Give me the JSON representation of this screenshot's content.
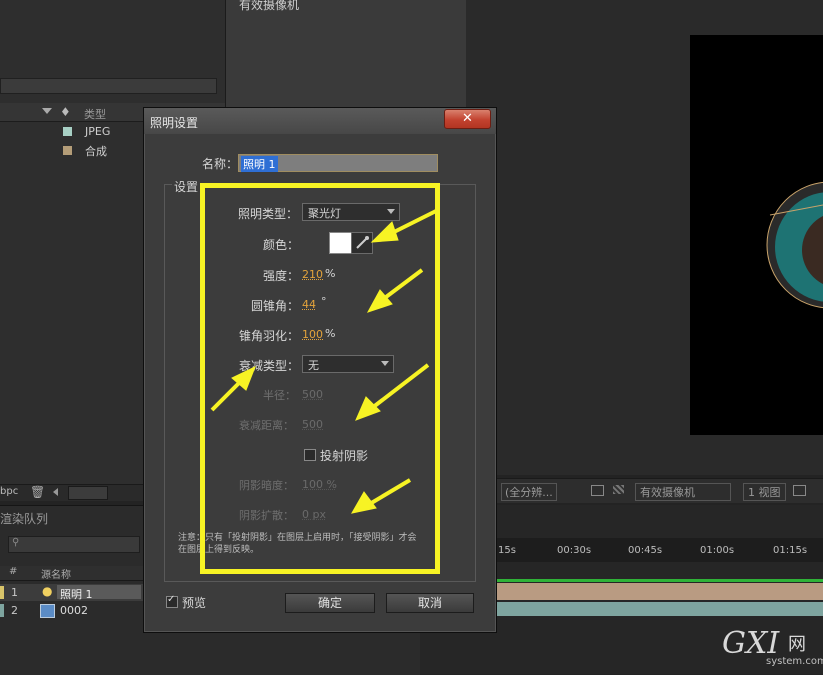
{
  "project": {
    "header_type": "类型",
    "items": [
      {
        "type": "JPEG",
        "swatch": "#a7cfc4"
      },
      {
        "type": "合成",
        "swatch": "#b49d78"
      }
    ]
  },
  "middle": {
    "title": "有效摄像机"
  },
  "comp_bar": {
    "zoom": "(全分辨...",
    "camera": "有效摄像机",
    "view": "1 视图"
  },
  "timeline": {
    "render_queue": "渲染队列",
    "cols": {
      "num": "#",
      "source": "源名称"
    },
    "layers": [
      {
        "num": "1",
        "name": "照明 1"
      },
      {
        "num": "2",
        "name": "0002"
      }
    ],
    "ticks": [
      "15s",
      "00:30s",
      "00:45s",
      "01:00s",
      "01:15s"
    ],
    "bpc": "bpc"
  },
  "dialog": {
    "title": "照明设置",
    "close": "✕",
    "name_label": "名称：",
    "name_value": "照明 1",
    "group_label": "设置",
    "light_type_label": "照明类型：",
    "light_type_value": "聚光灯",
    "color_label": "颜色：",
    "color_value": "#ffffff",
    "intensity_label": "强度：",
    "intensity_value": "210",
    "intensity_unit": "%",
    "cone_angle_label": "圆锥角：",
    "cone_angle_value": "44",
    "cone_angle_unit": "°",
    "cone_feather_label": "锥角羽化：",
    "cone_feather_value": "100",
    "cone_feather_unit": "%",
    "falloff_label": "衰减类型：",
    "falloff_value": "无",
    "radius_label": "半径：",
    "radius_value": "500",
    "falloff_distance_label": "衰减距离：",
    "falloff_distance_value": "500",
    "cast_shadows_label": "投射阴影",
    "shadow_darkness_label": "阴影暗度：",
    "shadow_darkness_value": "100 %",
    "shadow_diffusion_label": "阴影扩散：",
    "shadow_diffusion_value": "0 px",
    "note_line1": "注意：只有「投射阴影」在图层上启用时，「接受阴影」才会",
    "note_line2": "在图层上得到反映。",
    "preview_label": "预览",
    "ok_label": "确定",
    "cancel_label": "取消"
  },
  "watermark": {
    "logo": "GXI",
    "site_cn": "网",
    "site": "system.com"
  },
  "colors": {
    "annotation": "#f7f324",
    "accent_value": "#e3a33b"
  }
}
